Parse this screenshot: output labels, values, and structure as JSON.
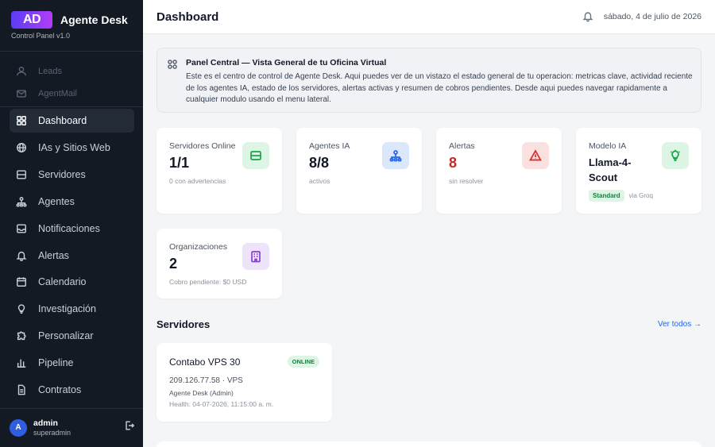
{
  "app": {
    "logo_text": "AD",
    "name": "Agente Desk",
    "subtitle": "Control Panel v1.0"
  },
  "sidebar": {
    "top_items": [
      {
        "label": "Leads",
        "icon": "user-icon"
      },
      {
        "label": "AgentMail",
        "icon": "mail-icon"
      }
    ],
    "items": [
      {
        "label": "Dashboard",
        "icon": "grid-icon",
        "active": true
      },
      {
        "label": "IAs y Sitios Web",
        "icon": "globe-icon"
      },
      {
        "label": "Servidores",
        "icon": "server-icon"
      },
      {
        "label": "Agentes",
        "icon": "network-icon"
      },
      {
        "label": "Notificaciones",
        "icon": "inbox-icon"
      },
      {
        "label": "Alertas",
        "icon": "bell-icon"
      },
      {
        "label": "Calendario",
        "icon": "calendar-icon"
      },
      {
        "label": "Investigación",
        "icon": "lightbulb-icon"
      },
      {
        "label": "Personalizar",
        "icon": "puzzle-icon"
      },
      {
        "label": "Pipeline",
        "icon": "bar-chart-icon"
      },
      {
        "label": "Contratos",
        "icon": "document-icon"
      }
    ],
    "user": {
      "initial": "A",
      "name": "admin",
      "role": "superadmin"
    }
  },
  "header": {
    "title": "Dashboard",
    "date": "sábado, 4 de julio de 2026"
  },
  "info_panel": {
    "title": "Panel Central — Vista General de tu Oficina Virtual",
    "text": "Este es el centro de control de Agente Desk. Aqui puedes ver de un vistazo el estado general de tu operacion: metricas clave, actividad reciente de los agentes IA, estado de los servidores, alertas activas y resumen de cobros pendientes. Desde aqui puedes navegar rapidamente a cualquier modulo usando el menu lateral."
  },
  "stats": {
    "servers": {
      "label": "Servidores Online",
      "value": "1/1",
      "sub": "0 con advertencias",
      "icon": "server-icon"
    },
    "agents": {
      "label": "Agentes IA",
      "value": "8/8",
      "sub": "activos",
      "icon": "network-icon"
    },
    "alerts": {
      "label": "Alertas",
      "value": "8",
      "sub": "sin resolver",
      "icon": "warning-icon",
      "value_color": "#c62828"
    },
    "model": {
      "label": "Modelo IA",
      "value": "Llama-4-Scout",
      "badge": "Standard",
      "note": "via Groq",
      "icon": "lightbulb-icon"
    },
    "orgs": {
      "label": "Organizaciones",
      "value": "2",
      "sub": "Cobro pendiente: $0 USD",
      "icon": "building-icon"
    }
  },
  "servers_section": {
    "title": "Servidores",
    "see_all": "Ver todos →",
    "servers": [
      {
        "name": "Contabo VPS 30",
        "status": "ONLINE",
        "ip": "209.126.77.58 · VPS",
        "owner": "Agente Desk (Admin)",
        "health": "Health: 04-07-2026, 11:15:00 a. m."
      }
    ]
  }
}
